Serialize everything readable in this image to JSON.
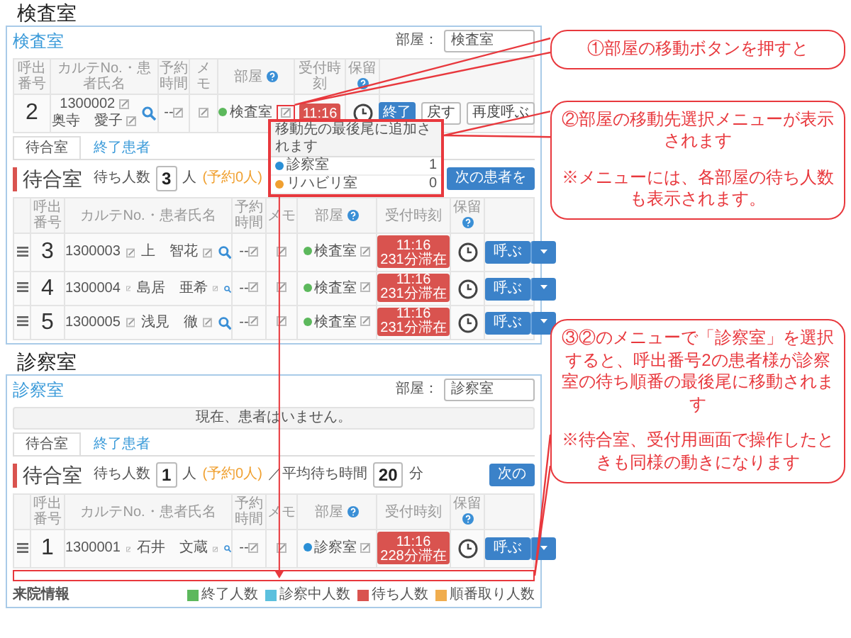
{
  "sections": [
    {
      "title": "検査室",
      "panel": {
        "room_name": "検査室",
        "room_caption": "部屋：",
        "room_select": "検査室",
        "current": {
          "columns": [
            "呼出番号",
            "カルテNo.・患者氏名",
            "予約時間",
            "メモ",
            "部屋",
            "受付時刻",
            "保留"
          ],
          "row": {
            "number": "2",
            "karte": "1300002",
            "name": "奥寺　愛子",
            "reserved_time": "--",
            "room": "検査室",
            "color": "#5cb85c",
            "time": "11:16",
            "buttons": [
              "終了",
              "戻す",
              "再度呼ぶ"
            ]
          }
        },
        "tabs": [
          {
            "label": "待合室",
            "selected": true
          },
          {
            "label": "終了患者",
            "selected": false
          }
        ],
        "waiting": {
          "title": "待合室",
          "count_label": "待ち人数",
          "count": "3",
          "unit": "人",
          "reserved": "(予約0人)",
          "next_button": "次の患者を"
        },
        "columns": [
          "呼出番号",
          "カルテNo.・患者氏名",
          "予約時間",
          "メモ",
          "部屋",
          "受付時刻",
          "保留"
        ],
        "rows": [
          {
            "number": "3",
            "karte": "1300003",
            "name": "上　智花",
            "reserved_time": "--",
            "room": "検査室",
            "color": "#5cb85c",
            "time": "11:16",
            "stay": "231分滞在",
            "call_button": "呼ぶ"
          },
          {
            "number": "4",
            "karte": "1300004",
            "name": "島居　亜希",
            "reserved_time": "--",
            "room": "検査室",
            "color": "#5cb85c",
            "time": "11:16",
            "stay": "231分滞在",
            "call_button": "呼ぶ"
          },
          {
            "number": "5",
            "karte": "1300005",
            "name": "浅見　徹",
            "reserved_time": "--",
            "room": "検査室",
            "color": "#5cb85c",
            "time": "11:16",
            "stay": "231分滞在",
            "call_button": "呼ぶ"
          }
        ],
        "menu": {
          "header": "移動先の最後尾に追加されます",
          "items": [
            {
              "label": "診察室",
              "color": "#2a8fd6",
              "count": "1"
            },
            {
              "label": "リハビリ室",
              "color": "#f0a030",
              "count": "0"
            }
          ]
        }
      }
    },
    {
      "title": "診察室",
      "panel": {
        "room_name": "診察室",
        "room_caption": "部屋：",
        "room_select": "診察室",
        "notice": "現在、患者はいません。",
        "tabs": [
          {
            "label": "待合室",
            "selected": true
          },
          {
            "label": "終了患者",
            "selected": false
          }
        ],
        "waiting": {
          "title": "待合室",
          "count_label": "待ち人数",
          "count": "1",
          "unit": "人",
          "reserved": "(予約0人)",
          "avg_label": "／平均待ち時間",
          "avg": "20",
          "avg_unit": "分",
          "next_button": "次の"
        },
        "columns": [
          "呼出番号",
          "カルテNo.・患者氏名",
          "予約時間",
          "メモ",
          "部屋",
          "受付時刻",
          "保留"
        ],
        "rows": [
          {
            "number": "1",
            "karte": "1300001",
            "name": "石井　文蔵",
            "reserved_time": "--",
            "room": "診察室",
            "color": "#2a8fd6",
            "time": "11:16",
            "stay": "228分滞在",
            "call_button": "呼ぶ"
          }
        ],
        "drop_target": true,
        "footer": {
          "title": "来院情報",
          "legend": [
            {
              "label": "終了人数",
              "color": "#5cb85c"
            },
            {
              "label": "診察中人数",
              "color": "#5bc0de"
            },
            {
              "label": "待ち人数",
              "color": "#d9534f"
            },
            {
              "label": "順番取り人数",
              "color": "#f0ad4e"
            }
          ]
        }
      }
    }
  ],
  "callouts": [
    {
      "text": "①部屋の移動ボタンを押すと"
    },
    {
      "text": "②部屋の移動先選択メニューが表示されます",
      "note": "※メニューには、各部屋の待ち人数も表示されます。"
    },
    {
      "text": "③②のメニューで「診察室」を選択すると、呼出番号2の患者様が診察室の待ち順番の最後尾に移動されます",
      "note": "※待合室、受付用画面で操作したときも同様の動きになります"
    }
  ]
}
